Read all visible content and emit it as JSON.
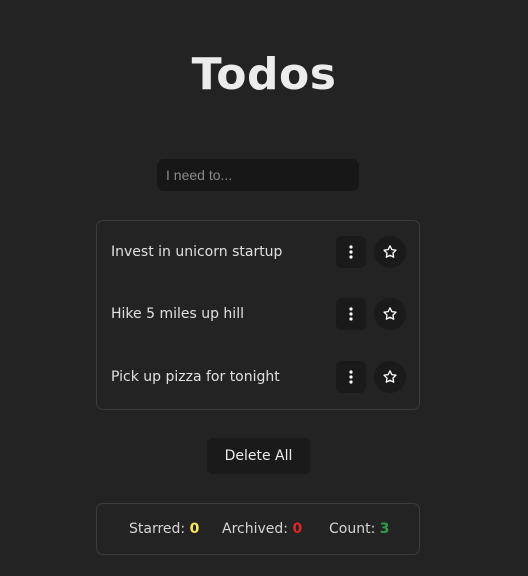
{
  "header": {
    "title": "Todos"
  },
  "new_todo": {
    "placeholder": "I need to..."
  },
  "todos": [
    {
      "label": "Invest in unicorn startup",
      "starred": false
    },
    {
      "label": "Hike 5 miles up hill",
      "starred": false
    },
    {
      "label": "Pick up pizza for tonight",
      "starred": false
    }
  ],
  "actions": {
    "delete_all_label": "Delete All"
  },
  "stats": {
    "starred_label": "Starred:",
    "starred_value": "0",
    "archived_label": "Archived:",
    "archived_value": "0",
    "count_label": "Count:",
    "count_value": "3"
  },
  "colors": {
    "background": "#232323",
    "starred": "#f5e663",
    "archived": "#e02424",
    "count": "#2e9e4a"
  },
  "icons": {
    "menu": "vertical-dots-icon",
    "star": "star-outline-icon"
  }
}
